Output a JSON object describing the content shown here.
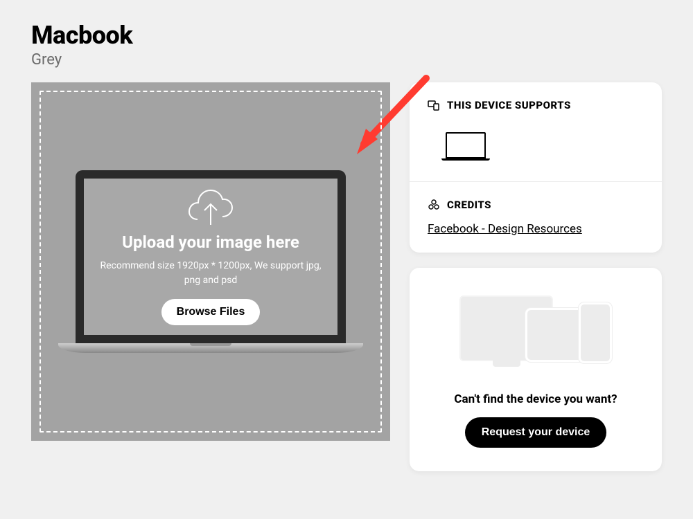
{
  "header": {
    "title": "Macbook",
    "subtitle": "Grey"
  },
  "upload": {
    "title": "Upload your image here",
    "hint": "Recommend size 1920px * 1200px, We support jpg, png and psd",
    "browse_label": "Browse Files"
  },
  "sidebar": {
    "supports": {
      "title": "THIS DEVICE SUPPORTS"
    },
    "credits": {
      "title": "CREDITS",
      "link_text": "Facebook - Design Resources"
    },
    "request": {
      "title": "Can't find the device you want?",
      "button_label": "Request your device"
    }
  }
}
